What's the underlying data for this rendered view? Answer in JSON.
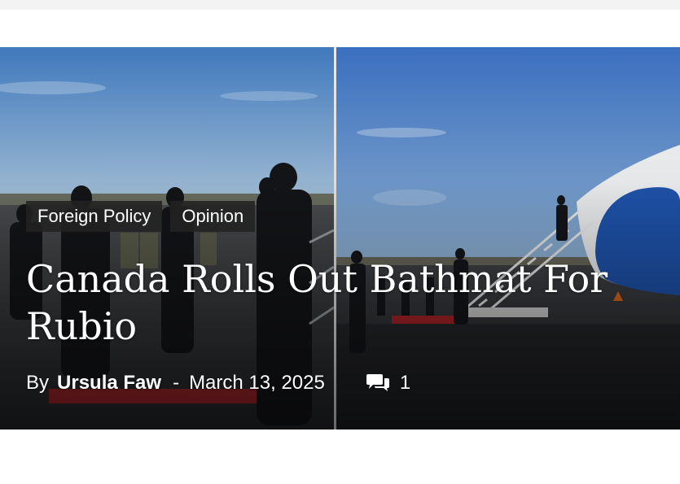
{
  "article": {
    "tags": [
      "Foreign Policy",
      "Opinion"
    ],
    "headline": "Canada Rolls Out Bathmat For Rubio",
    "byline_prefix": "By",
    "author": "Ursula Faw",
    "separator": "-",
    "date": "March 13, 2025",
    "comment_count": "1"
  },
  "icons": {
    "comments": "comments-icon"
  },
  "colors": {
    "tag_background": "#222222",
    "headline_text": "#ffffff",
    "sky": "#4a84c8",
    "tarmac": "#2c2f33",
    "red_carpet": "#b2262b"
  }
}
